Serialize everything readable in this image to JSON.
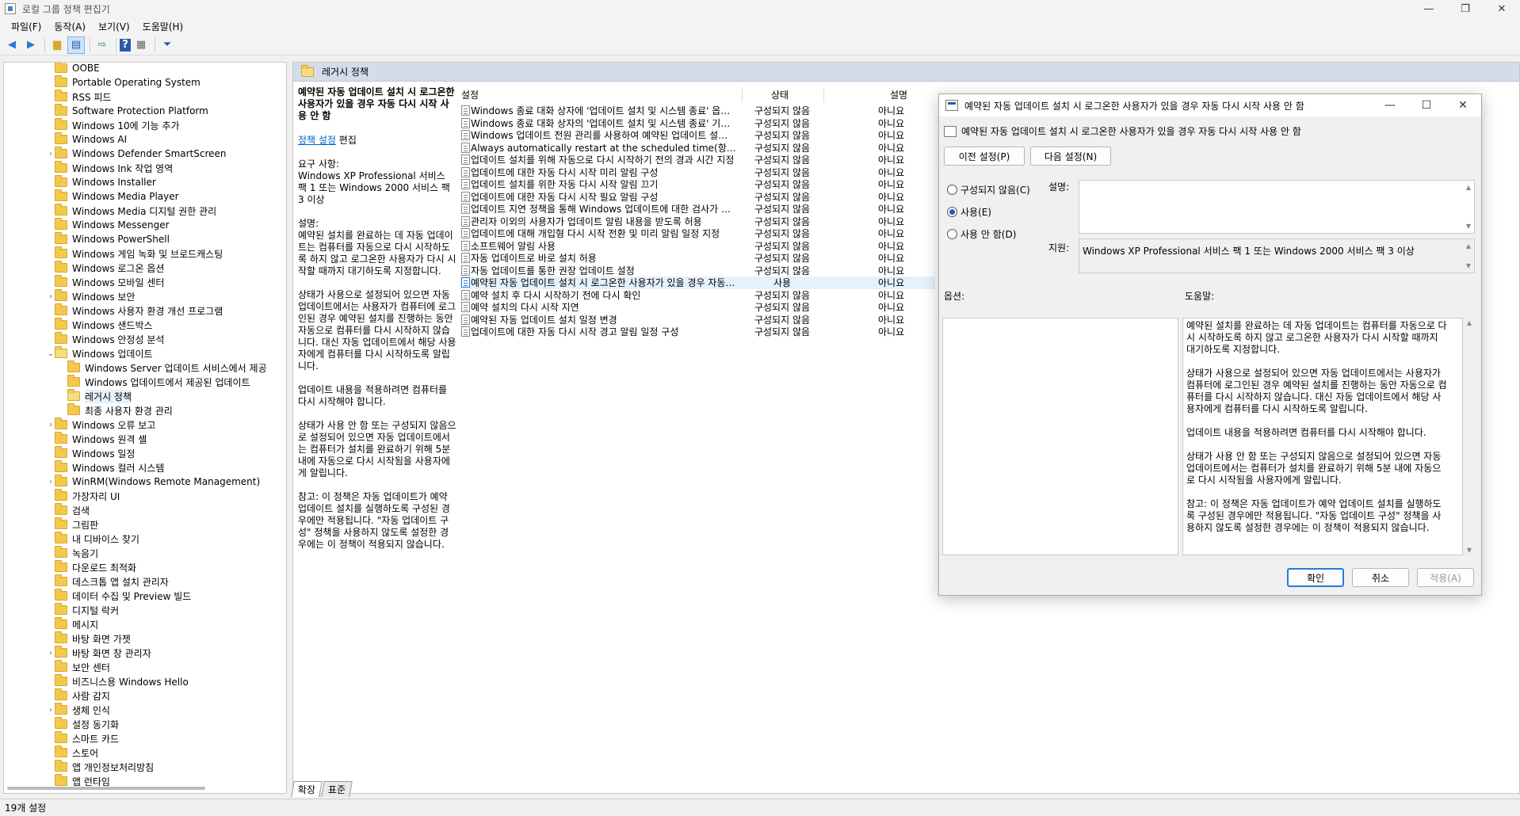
{
  "window": {
    "title": "로컬 그룹 정책 편집기"
  },
  "menu": [
    "파일(F)",
    "동작(A)",
    "보기(V)",
    "도움말(H)"
  ],
  "toolbar": {
    "icons": [
      "back-arrow-icon",
      "forward-arrow-icon",
      "up-folder-icon",
      "show-tree-icon",
      "export-list-icon",
      "help-icon",
      "properties-icon",
      "filter-icon"
    ]
  },
  "tree": [
    {
      "label": "OOBE",
      "level": 0
    },
    {
      "label": "Portable Operating System",
      "level": 0
    },
    {
      "label": "RSS 피드",
      "level": 0
    },
    {
      "label": "Software Protection Platform",
      "level": 0
    },
    {
      "label": "Windows 10에 기능 추가",
      "level": 0
    },
    {
      "label": "Windows AI",
      "level": 0
    },
    {
      "label": "Windows Defender SmartScreen",
      "level": 0,
      "expander": "›"
    },
    {
      "label": "Windows Ink 작업 영역",
      "level": 0
    },
    {
      "label": "Windows Installer",
      "level": 0
    },
    {
      "label": "Windows Media Player",
      "level": 0
    },
    {
      "label": "Windows Media 디지털 권한 관리",
      "level": 0
    },
    {
      "label": "Windows Messenger",
      "level": 0
    },
    {
      "label": "Windows PowerShell",
      "level": 0
    },
    {
      "label": "Windows 게임 녹화 및 브로드캐스팅",
      "level": 0
    },
    {
      "label": "Windows 로그온 옵션",
      "level": 0
    },
    {
      "label": "Windows 모바일 센터",
      "level": 0
    },
    {
      "label": "Windows 보안",
      "level": 0,
      "expander": "›"
    },
    {
      "label": "Windows 사용자 환경 개선 프로그램",
      "level": 0
    },
    {
      "label": "Windows 샌드박스",
      "level": 0
    },
    {
      "label": "Windows 안정성 분석",
      "level": 0
    },
    {
      "label": "Windows 업데이트",
      "level": 0,
      "expander": "⌄",
      "open": true
    },
    {
      "label": "Windows Server 업데이트 서비스에서 제공",
      "level": 1
    },
    {
      "label": "Windows 업데이트에서 제공된 업데이트",
      "level": 1
    },
    {
      "label": "레거시 정책",
      "level": 1,
      "selected": true,
      "open": true
    },
    {
      "label": "최종 사용자 환경 관리",
      "level": 1
    },
    {
      "label": "Windows 오류 보고",
      "level": 0,
      "expander": "›"
    },
    {
      "label": "Windows 원격 셸",
      "level": 0
    },
    {
      "label": "Windows 일정",
      "level": 0
    },
    {
      "label": "Windows 컬러 시스템",
      "level": 0
    },
    {
      "label": "WinRM(Windows Remote Management)",
      "level": 0,
      "expander": "›"
    },
    {
      "label": "가장자리 UI",
      "level": 0
    },
    {
      "label": "검색",
      "level": 0
    },
    {
      "label": "그림판",
      "level": 0
    },
    {
      "label": "내 디바이스 찾기",
      "level": 0
    },
    {
      "label": "녹음기",
      "level": 0
    },
    {
      "label": "다운로드 최적화",
      "level": 0
    },
    {
      "label": "데스크톱 앱 설치 관리자",
      "level": 0
    },
    {
      "label": "데이터 수집 및 Preview 빌드",
      "level": 0
    },
    {
      "label": "디지털 락커",
      "level": 0
    },
    {
      "label": "메시지",
      "level": 0
    },
    {
      "label": "바탕 화면 가젯",
      "level": 0
    },
    {
      "label": "바탕 화면 창 관리자",
      "level": 0,
      "expander": "›"
    },
    {
      "label": "보안 센터",
      "level": 0
    },
    {
      "label": "비즈니스용 Windows Hello",
      "level": 0
    },
    {
      "label": "사람 감지",
      "level": 0
    },
    {
      "label": "생체 인식",
      "level": 0,
      "expander": "›"
    },
    {
      "label": "설정 동기화",
      "level": 0
    },
    {
      "label": "스마트 카드",
      "level": 0
    },
    {
      "label": "스토어",
      "level": 0
    },
    {
      "label": "앱 개인정보처리방침",
      "level": 0
    },
    {
      "label": "앱 런타임",
      "level": 0
    }
  ],
  "right": {
    "header": "레거시 정책",
    "extended": {
      "title": "예약된 자동 업데이트 설치 시 로그온한 사용자가 있을 경우 자동 다시 시작 사용 안 함",
      "edit_link": "정책 설정",
      "edit_suffix": " 편집",
      "requirements_label": "요구 사항:",
      "requirements": "Windows XP Professional 서비스 팩 1 또는 Windows 2000 서비스 팩 3 이상",
      "description_label": "설명:",
      "paragraphs": [
        "예약된 설치를 완료하는 데 자동 업데이트는 컴퓨터를 자동으로 다시 시작하도록 하지 않고 로그온한 사용자가 다시 시작할 때까지 대기하도록 지정합니다.",
        "상태가 사용으로 설정되어 있으면 자동 업데이트에서는 사용자가 컴퓨터에 로그인된 경우 예약된 설치를 진행하는 동안 자동으로 컴퓨터를 다시 시작하지 않습니다. 대신 자동 업데이트에서 해당 사용자에게 컴퓨터를 다시 시작하도록 알립니다.",
        "업데이트 내용을 적용하려면 컴퓨터를 다시 시작해야 합니다.",
        "상태가 사용 안 함 또는 구성되지 않음으로 설정되어 있으면 자동 업데이트에서는 컴퓨터가 설치를 완료하기 위해 5분 내에 자동으로 다시 시작됨을 사용자에게 알립니다.",
        "참고: 이 정책은 자동 업데이트가 예약 업데이트 설치를 실행하도록 구성된 경우에만 적용됩니다. \"자동 업데이트 구성\" 정책을 사용하지 않도록 설정한 경우에는 이 정책이 적용되지 않습니다."
      ]
    },
    "columns": {
      "setting": "설정",
      "state": "상태",
      "comment": "설명"
    },
    "rows": [
      {
        "name": "Windows 종료 대화 상자에 '업데이트 설치 및 시스템 종료' 옵션 표시 안 함",
        "state": "구성되지 않음",
        "comment": "아니요"
      },
      {
        "name": "Windows 종료 대화 상자의 '업데이트 설치 및 시스템 종료' 기본 옵션 조정 안 함",
        "state": "구성되지 않음",
        "comment": "아니요"
      },
      {
        "name": "Windows 업데이트 전원 관리를 사용하여 예약된 업데이트 설치를 위해 시스템 절전 모드 해제",
        "state": "구성되지 않음",
        "comment": "아니요"
      },
      {
        "name": "Always automatically restart at the scheduled time(항상 예약된 시간에 자동으로 다시 시작)",
        "state": "구성되지 않음",
        "comment": "아니요"
      },
      {
        "name": "업데이트 설치를 위해 자동으로 다시 시작하기 전의 경과 시간 지정",
        "state": "구성되지 않음",
        "comment": "아니요"
      },
      {
        "name": "업데이트에 대한 자동 다시 시작 미리 알림 구성",
        "state": "구성되지 않음",
        "comment": "아니요"
      },
      {
        "name": "업데이트 설치를 위한 자동 다시 시작 알림 끄기",
        "state": "구성되지 않음",
        "comment": "아니요"
      },
      {
        "name": "업데이트에 대한 자동 다시 시작 필요 알림 구성",
        "state": "구성되지 않음",
        "comment": "아니요"
      },
      {
        "name": "업데이트 지연 정책을 통해 Windows 업데이트에 대한 검사가 발생하지 않도록 함",
        "state": "구성되지 않음",
        "comment": "아니요"
      },
      {
        "name": "관리자 이외의 사용자가 업데이트 알림 내용을 받도록 허용",
        "state": "구성되지 않음",
        "comment": "아니요"
      },
      {
        "name": "업데이트에 대해 개입형 다시 시작 전환 및 미리 알림 일정 지정",
        "state": "구성되지 않음",
        "comment": "아니요"
      },
      {
        "name": "소프트웨어 알림 사용",
        "state": "구성되지 않음",
        "comment": "아니요"
      },
      {
        "name": "자동 업데이트로 바로 설치 허용",
        "state": "구성되지 않음",
        "comment": "아니요"
      },
      {
        "name": "자동 업데이트를 통한 권장 업데이트 설정",
        "state": "구성되지 않음",
        "comment": "아니요"
      },
      {
        "name": "예약된 자동 업데이트 설치 시 로그온한 사용자가 있을 경우 자동 다시 시작 사용 안 함",
        "state": "사용",
        "comment": "아니요",
        "selected": true
      },
      {
        "name": "예약 설치 후 다시 시작하기 전에 다시 확인",
        "state": "구성되지 않음",
        "comment": "아니요"
      },
      {
        "name": "예약 설치의 다시 시작 지연",
        "state": "구성되지 않음",
        "comment": "아니요"
      },
      {
        "name": "예약된 자동 업데이트 설치 일정 변경",
        "state": "구성되지 않음",
        "comment": "아니요"
      },
      {
        "name": "업데이트에 대한 자동 다시 시작 경고 알림 일정 구성",
        "state": "구성되지 않음",
        "comment": "아니요"
      }
    ]
  },
  "tabs": [
    "확장",
    "표준"
  ],
  "status": "19개 설정",
  "dialog": {
    "title": "예약된 자동 업데이트 설치 시 로그온한 사용자가 있을 경우 자동 다시 시작 사용 안 함",
    "setting_name": "예약된 자동 업데이트 설치 시 로그온한 사용자가 있을 경우 자동 다시 시작 사용 안 함",
    "prev_button": "이전 설정(P)",
    "next_button": "다음 설정(N)",
    "radios": [
      {
        "label": "구성되지 않음(C)",
        "checked": false
      },
      {
        "label": "사용(E)",
        "checked": true
      },
      {
        "label": "사용 안 함(D)",
        "checked": false
      }
    ],
    "comment_label": "설명:",
    "comment_value": "",
    "supported_label": "지원:",
    "supported_value": "Windows XP Professional 서비스 팩 1 또는 Windows 2000 서비스 팩 3 이상",
    "options_label": "옵션:",
    "help_label": "도움말:",
    "help_paragraphs": [
      "예약된 설치를 완료하는 데 자동 업데이트는 컴퓨터를 자동으로 다시 시작하도록 하지 않고 로그온한 사용자가 다시 시작할 때까지 대기하도록 지정합니다.",
      "상태가 사용으로 설정되어 있으면 자동 업데이트에서는 사용자가 컴퓨터에 로그인된 경우 예약된 설치를 진행하는 동안 자동으로 컴퓨터를 다시 시작하지 않습니다. 대신 자동 업데이트에서 해당 사용자에게 컴퓨터를 다시 시작하도록 알립니다.",
      "업데이트 내용을 적용하려면 컴퓨터를 다시 시작해야 합니다.",
      "상태가 사용 안 함 또는 구성되지 않음으로 설정되어 있으면 자동 업데이트에서는 컴퓨터가 설치를 완료하기 위해 5분 내에 자동으로 다시 시작됨을 사용자에게 알립니다.",
      "참고: 이 정책은 자동 업데이트가 예약 업데이트 설치를 실행하도록 구성된 경우에만 적용됩니다. \"자동 업데이트 구성\" 정책을 사용하지 않도록 설정한 경우에는 이 정책이 적용되지 않습니다."
    ],
    "ok_button": "확인",
    "cancel_button": "취소",
    "apply_button": "적용(A)"
  }
}
